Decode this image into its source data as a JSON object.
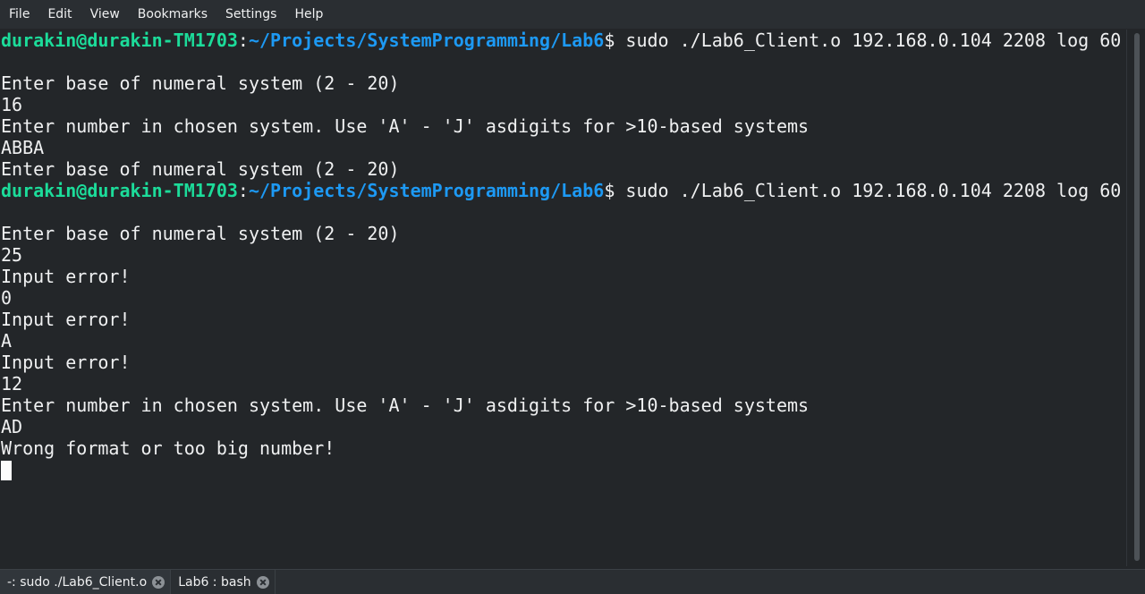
{
  "menu": {
    "items": [
      "File",
      "Edit",
      "View",
      "Bookmarks",
      "Settings",
      "Help"
    ]
  },
  "terminal": {
    "prompt": {
      "user": "durakin@durakin-TM1703",
      "sep": ":",
      "path": "~/Projects/SystemProgramming/Lab6",
      "symbol": "$",
      "command": " sudo ./Lab6_Client.o 192.168.0.104 2208 log 60"
    },
    "lines": [
      "",
      "",
      "Enter base of numeral system (2 - 20)",
      "16",
      "Enter number in chosen system. Use 'A' - 'J' asdigits for >10-based systems",
      "ABBA",
      "Enter base of numeral system (2 - 20)",
      "",
      "",
      "Enter base of numeral system (2 - 20)",
      "25",
      "Input error!",
      "0",
      "Input error!",
      "A",
      "Input error!",
      "12",
      "Enter number in chosen system. Use 'A' - 'J' asdigits for >10-based systems",
      "AD",
      "Wrong format or too big number!"
    ]
  },
  "tabs": [
    {
      "label": "-: sudo ./Lab6_Client.o",
      "active": true
    },
    {
      "label": "Lab6 : bash",
      "active": false
    }
  ],
  "colors": {
    "background": "#232629",
    "foreground": "#eff0f1",
    "user": "#1cdc9a",
    "path": "#1d99f3"
  }
}
